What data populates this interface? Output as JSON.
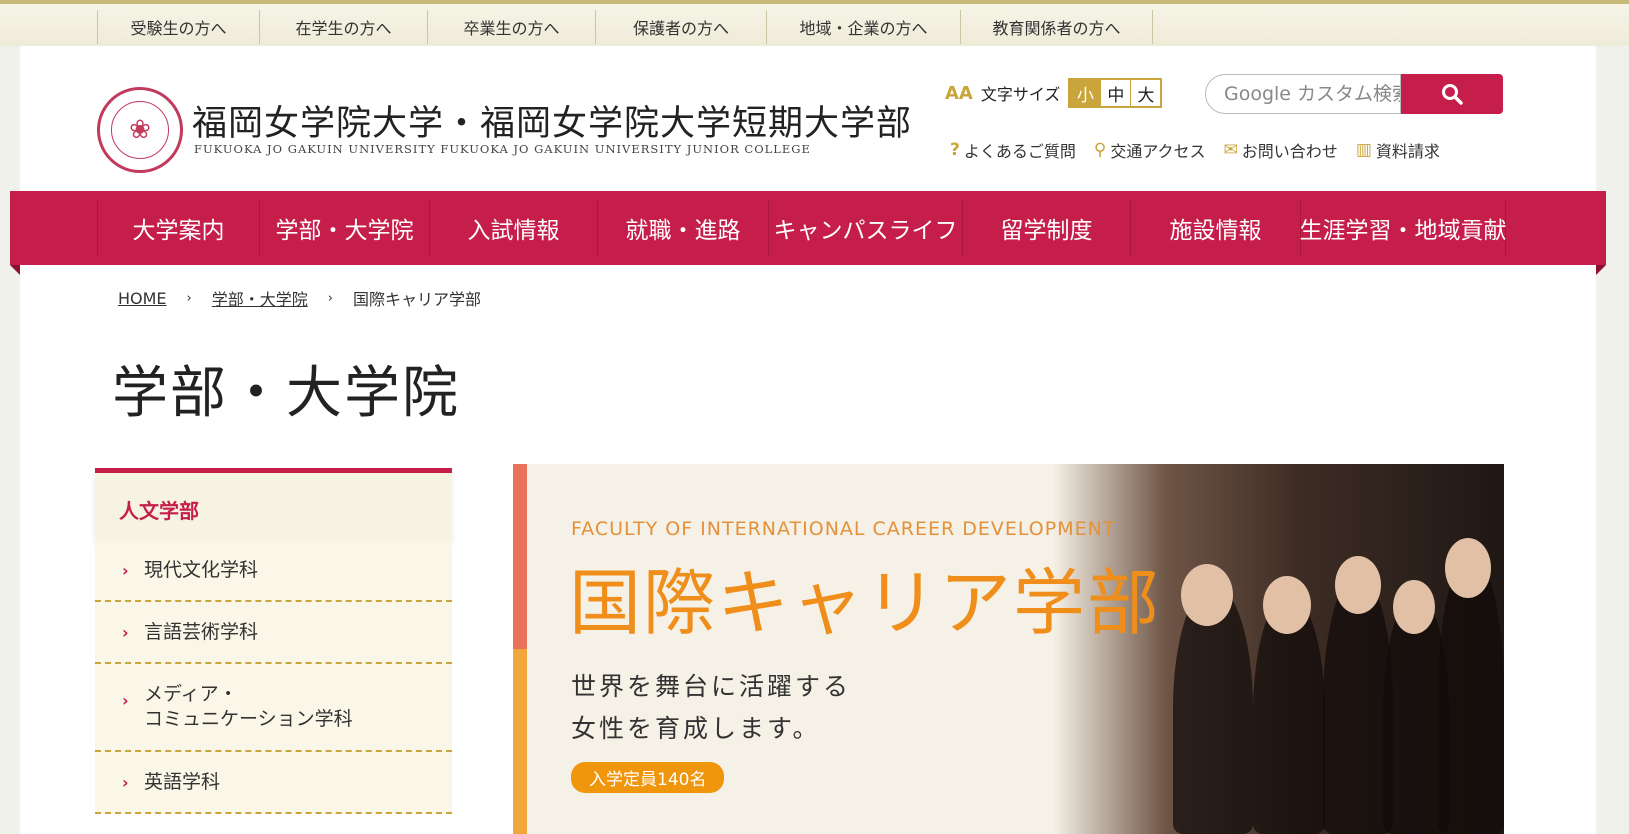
{
  "audience_nav": [
    {
      "label": "受験生の方へ"
    },
    {
      "label": "在学生の方へ"
    },
    {
      "label": "卒業生の方へ"
    },
    {
      "label": "保護者の方へ"
    },
    {
      "label": "地域・企業の方へ"
    },
    {
      "label": "教育関係者の方へ"
    }
  ],
  "header": {
    "title": "福岡女学院大学・福岡女学院大学短期大学部",
    "subtitle": "FUKUOKA JO GAKUIN UNIVERSITY    FUKUOKA JO GAKUIN UNIVERSITY JUNIOR COLLEGE",
    "font_size_label": "文字サイズ",
    "font_sizes": [
      "小",
      "中",
      "大"
    ],
    "font_size_selected": "小",
    "search_placeholder": "Google カスタム検索",
    "quick_links": [
      {
        "label": "よくあるご質問",
        "icon": "question-icon"
      },
      {
        "label": "交通アクセス",
        "icon": "map-pin-icon"
      },
      {
        "label": "お問い合わせ",
        "icon": "mail-icon"
      },
      {
        "label": "資料請求",
        "icon": "book-icon"
      }
    ]
  },
  "main_nav": [
    {
      "label": "大学案内"
    },
    {
      "label": "学部・大学院"
    },
    {
      "label": "入試情報"
    },
    {
      "label": "就職・進路"
    },
    {
      "label": "キャンパスライフ"
    },
    {
      "label": "留学制度"
    },
    {
      "label": "施設情報"
    },
    {
      "label": "生涯学習・地域貢献"
    }
  ],
  "breadcrumb": {
    "home": "HOME",
    "section": "学部・大学院",
    "current": "国際キャリア学部"
  },
  "page_title": "学部・大学院",
  "sidebar": {
    "heading": "人文学部",
    "items": [
      {
        "label": "現代文化学科"
      },
      {
        "label": "言語芸術学科"
      },
      {
        "label": "メディア・\nコミュニケーション学科"
      },
      {
        "label": "英語学科"
      }
    ]
  },
  "hero": {
    "english_title": "FACULTY OF INTERNATIONAL CAREER DEVELOPMENT",
    "japanese_title": "国際キャリア学部",
    "lead_line1": "世界を舞台に活躍する",
    "lead_line2": "女性を育成します。",
    "capacity_badge": "入学定員140名"
  },
  "colors": {
    "brand": "#c61e4a",
    "gold": "#c9a53b",
    "accent_orange": "#ef8e1a"
  }
}
